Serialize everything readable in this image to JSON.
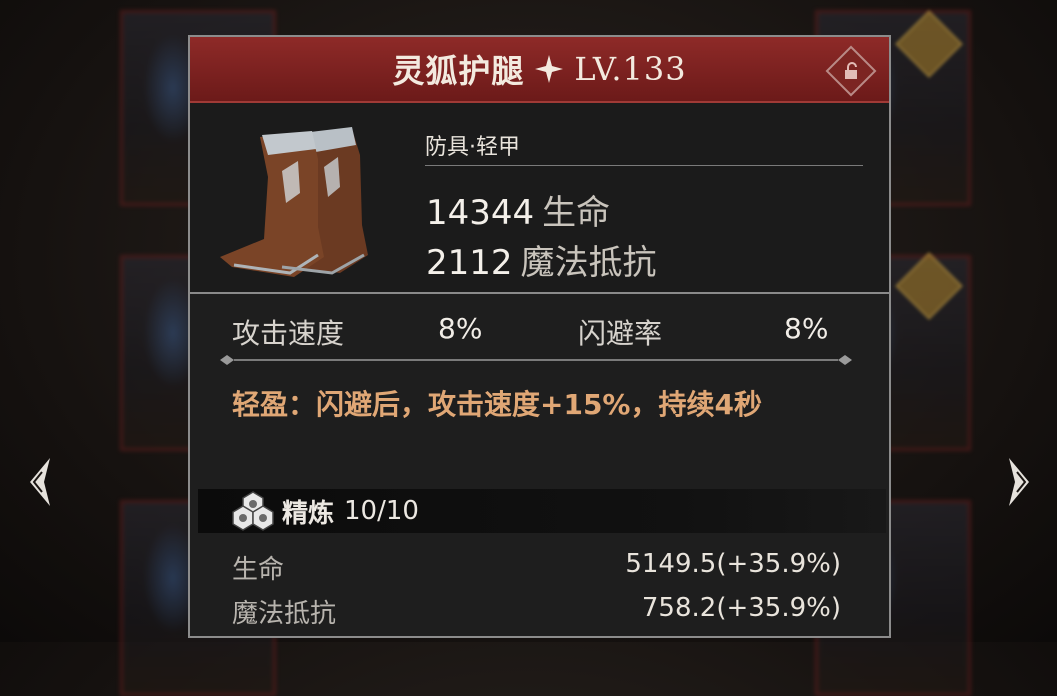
{
  "item": {
    "name": "灵狐护腿",
    "level": "LV.133",
    "type": "防具·轻甲",
    "main_stats": [
      {
        "value": "14344",
        "label": "生命"
      },
      {
        "value": "2112",
        "label": "魔法抵抗"
      }
    ],
    "sub_stats": [
      {
        "label": "攻击速度",
        "value": "8%"
      },
      {
        "label": "闪避率",
        "value": "8%"
      }
    ],
    "effect_text": "轻盈：闪避后，攻击速度+15%，持续4秒",
    "refine": {
      "label": "精炼",
      "value": "10/10",
      "stats": [
        {
          "label": "生命",
          "value": "5149.5(+35.9%)"
        },
        {
          "label": "魔法抵抗",
          "value": "758.2(+35.9%)"
        }
      ]
    }
  },
  "colors": {
    "title_bar": "#8e2a28",
    "effect_text": "#e0a775",
    "panel_bg": "#1e1e1e"
  },
  "icons": [
    "star-icon",
    "lock-icon",
    "refine-orbs-icon",
    "arrow-left-icon",
    "arrow-right-icon"
  ]
}
